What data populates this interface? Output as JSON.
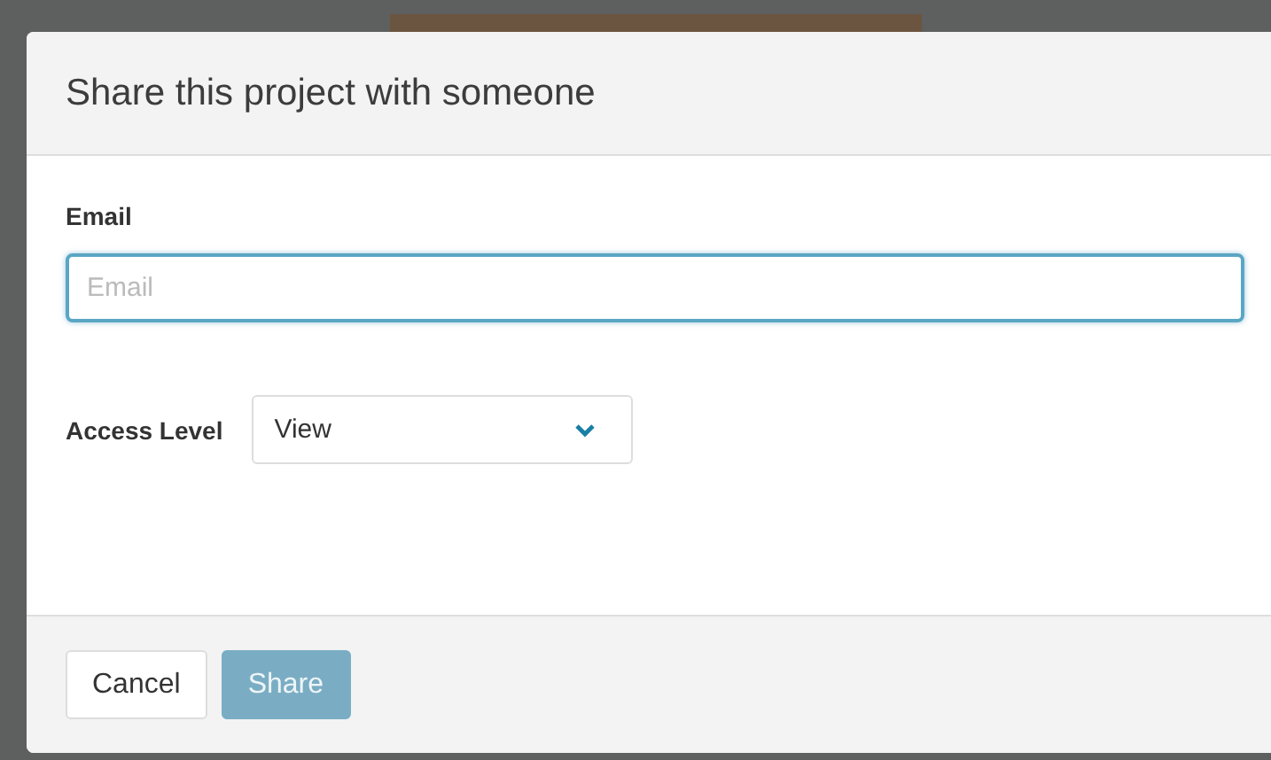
{
  "dialog": {
    "title": "Share this project with someone",
    "email": {
      "label": "Email",
      "placeholder": "Email",
      "focused": true
    },
    "access_level": {
      "label": "Access Level",
      "value": "View"
    },
    "buttons": [
      {
        "label": "Cancel",
        "kind": "secondary",
        "disabled": false
      },
      {
        "label": "Share",
        "kind": "primary",
        "disabled": true
      }
    ]
  }
}
